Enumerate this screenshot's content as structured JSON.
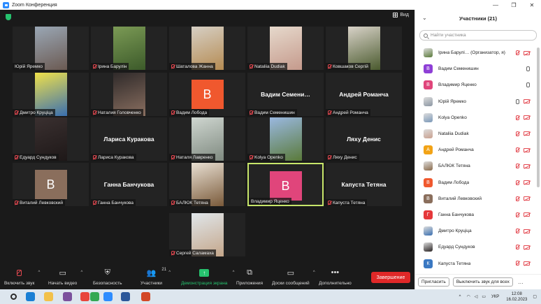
{
  "window": {
    "title": "Zoom Конференция",
    "controls": [
      "—",
      "❐",
      "✕"
    ]
  },
  "gallery": {
    "view_label": "Вид",
    "tiles": [
      {
        "name": "Юрій Яремко",
        "type": "video",
        "mic_off": false,
        "colors": [
          "#9aa7b5",
          "#6b5a52"
        ]
      },
      {
        "name": "Ірина Барулін",
        "type": "video",
        "mic_off": true,
        "colors": [
          "#7b9a55",
          "#3c5a2a"
        ]
      },
      {
        "name": "Шаталова Жанна",
        "type": "video",
        "mic_off": true,
        "colors": [
          "#d6cfc4",
          "#b58b52"
        ]
      },
      {
        "name": "Nataliia Dudiak",
        "type": "video",
        "mic_off": true,
        "colors": [
          "#e6d9cc",
          "#c59a8c"
        ]
      },
      {
        "name": "Ковшаков Сергій",
        "type": "video",
        "mic_off": true,
        "colors": [
          "#d8d2c8",
          "#4a5a2e"
        ]
      },
      {
        "name": "Дмитро Круціца",
        "type": "video",
        "mic_off": true,
        "colors": [
          "#f0e14a",
          "#3a6fb0"
        ]
      },
      {
        "name": "Наталия Головченко",
        "type": "video",
        "mic_off": true,
        "colors": [
          "#2f2a2a",
          "#8a6f60"
        ]
      },
      {
        "name": "Вадим Лобода",
        "type": "avatar",
        "initial": "В",
        "avatar_color": "#f0582e",
        "mic_off": true
      },
      {
        "name": "Вадим Семенишин",
        "display": "Вадим Семени…",
        "type": "name",
        "mic_off": true
      },
      {
        "name": "Андрей Романча",
        "display": "Андрей Романча",
        "type": "name",
        "mic_off": true
      },
      {
        "name": "Едуард Сундуков",
        "type": "video",
        "mic_off": true,
        "colors": [
          "#3a3030",
          "#1e1818"
        ]
      },
      {
        "name": "Лариса Куракова",
        "display": "Лариса Куракова",
        "type": "name",
        "mic_off": true
      },
      {
        "name": "Наталя Лавренко",
        "type": "video",
        "mic_off": true,
        "colors": [
          "#cfd6d0",
          "#7f8a80"
        ]
      },
      {
        "name": "Kolya Openko",
        "type": "video",
        "mic_off": true,
        "colors": [
          "#9ab8e0",
          "#5a7a3a"
        ]
      },
      {
        "name": "Ляху Денис",
        "display": "Ляху Денис",
        "type": "name",
        "mic_off": true
      },
      {
        "name": "Виталий Левковский",
        "type": "avatar",
        "initial": "В",
        "avatar_color": "#8a6e5c",
        "mic_off": true
      },
      {
        "name": "Ганна Банчукова",
        "display": "Ганна Банчукова",
        "type": "name",
        "mic_off": true
      },
      {
        "name": "БАЛЮК Тетяна",
        "type": "video",
        "mic_off": true,
        "colors": [
          "#e8dfd2",
          "#7a5a3a"
        ]
      },
      {
        "name": "Владимир Яценко",
        "type": "avatar",
        "initial": "В",
        "avatar_color": "#e0457b",
        "mic_off": false,
        "active": true
      },
      {
        "name": "Капуста Тетяна",
        "display": "Капуста Тетяна",
        "type": "name",
        "mic_off": true
      },
      {
        "name": "Сергей Саламаха",
        "type": "video",
        "mic_off": true,
        "colors": [
          "#e0e6ea",
          "#c4a68a"
        ]
      }
    ]
  },
  "toolbar": {
    "audio_label": "Включить звук",
    "video_label": "Начать видео",
    "security_label": "Безопасность",
    "participants_label": "Участники",
    "participants_count": "21",
    "share_label": "Демонстрация экрана",
    "apps_label": "Приложения",
    "whiteboard_label": "Доски сообщений",
    "more_label": "Дополнительно",
    "end_label": "Завершение"
  },
  "panel": {
    "title": "Участники (21)",
    "search_placeholder": "Найти участника",
    "participants": [
      {
        "name": "Ірина Барулі…  (Организатор, я)",
        "avatar": "photo",
        "color": "#5a7a3a",
        "mic": "off",
        "cam": "off"
      },
      {
        "name": "Вадим Семенишин",
        "avatar": "В",
        "color": "#8e3fd6",
        "mic": "on",
        "cam": "none"
      },
      {
        "name": "Владимир Яценко",
        "avatar": "В",
        "color": "#e0457b",
        "mic": "on",
        "cam": "none"
      },
      {
        "name": "Юрій Яремко",
        "avatar": "photo",
        "color": "#8b96a3",
        "mic": "on",
        "cam": "off"
      },
      {
        "name": "Kolya Openko",
        "avatar": "photo",
        "color": "#7a98b8",
        "mic": "off",
        "cam": "off"
      },
      {
        "name": "Nataliia Dudiak",
        "avatar": "photo",
        "color": "#c9a08e",
        "mic": "off",
        "cam": "off"
      },
      {
        "name": "Андрей Романча",
        "avatar": "А",
        "color": "#f2a316",
        "mic": "off",
        "cam": "off"
      },
      {
        "name": "БАЛЮК Тетяна",
        "avatar": "photo",
        "color": "#8a6a4a",
        "mic": "off",
        "cam": "off"
      },
      {
        "name": "Вадим Лобода",
        "avatar": "В",
        "color": "#f0582e",
        "mic": "off",
        "cam": "off"
      },
      {
        "name": "Виталий Левковский",
        "avatar": "В",
        "color": "#8a6e5c",
        "mic": "off",
        "cam": "off"
      },
      {
        "name": "Ганна Банчукова",
        "avatar": "Г",
        "color": "#e5383b",
        "mic": "off",
        "cam": "off"
      },
      {
        "name": "Дмитро Круціца",
        "avatar": "photo",
        "color": "#3a6fb0",
        "mic": "off",
        "cam": "off"
      },
      {
        "name": "Едуард Сундуков",
        "avatar": "photo",
        "color": "#2a2424",
        "mic": "off",
        "cam": "off"
      },
      {
        "name": "Капуста Тетяна",
        "avatar": "К",
        "color": "#3a78c2",
        "mic": "off",
        "cam": "off"
      }
    ],
    "invite_label": "Пригласить",
    "mute_all_label": "Выключить звук для всех",
    "more_label": "…"
  },
  "taskbar": {
    "language": "УКР",
    "time": "12:08",
    "date": "16.02.2023",
    "apps": [
      {
        "name": "search",
        "color": "#2a2a2a"
      },
      {
        "name": "edge",
        "color": "#1a7fd4"
      },
      {
        "name": "files",
        "color": "#f2c14a"
      },
      {
        "name": "viber",
        "color": "#7b519d"
      },
      {
        "name": "chrome",
        "color": "#e8453c"
      },
      {
        "name": "chrome-2",
        "color": "#34a853"
      },
      {
        "name": "zoom",
        "color": "#2d8cff"
      },
      {
        "name": "word",
        "color": "#2b579a"
      },
      {
        "name": "powerpoint",
        "color": "#d24726"
      }
    ]
  }
}
